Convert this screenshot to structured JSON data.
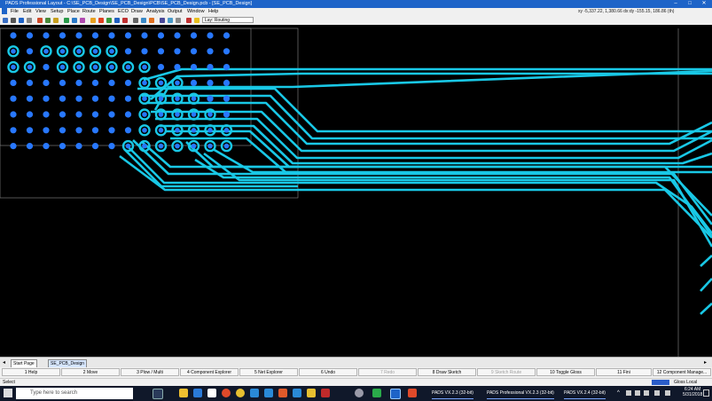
{
  "window": {
    "title": "PADS Professional Layout - C:\\SE_PCB_Design\\SE_PCB_Design\\PCB\\SE_PCB_Design.pcb - [SE_PCB_Design]",
    "controls": [
      "–",
      "□",
      "✕"
    ]
  },
  "menu": {
    "items": [
      "File",
      "Edit",
      "View",
      "Setup",
      "Place",
      "Route",
      "Planes",
      "ECO",
      "Draw",
      "Analysis",
      "Output",
      "Window",
      "Help"
    ],
    "coords": "xy -5,337.22, 1,380.66  dx:dy -155.15, 186.86 (th)"
  },
  "toolbar": {
    "layer_select": "Lay: Routing"
  },
  "sheet_tabs": [
    "Start Page",
    "SE_PCB_Design"
  ],
  "function_keys": [
    {
      "label": "1 Help",
      "enabled": true
    },
    {
      "label": "2 Move",
      "enabled": true
    },
    {
      "label": "3 Plow / Multi",
      "enabled": true
    },
    {
      "label": "4 Component Explorer",
      "enabled": true
    },
    {
      "label": "5 Net Explorer",
      "enabled": true
    },
    {
      "label": "6 Undo",
      "enabled": true
    },
    {
      "label": "7 Redo",
      "enabled": false
    },
    {
      "label": "8 Draw Sketch",
      "enabled": true
    },
    {
      "label": "9 Sketch Route",
      "enabled": false
    },
    {
      "label": "10 Toggle Gloss",
      "enabled": true
    },
    {
      "label": "11 Fini",
      "enabled": true
    },
    {
      "label": "12 Component Manage...",
      "enabled": true
    }
  ],
  "status": {
    "mode": "Select",
    "gloss": "Gloss Local"
  },
  "taskbar": {
    "search_placeholder": "Type here to search",
    "tasks": [
      "PADS VX.2.3 (32-bit)",
      "PADS Professional VX.2.3 (32-bit)",
      "PADS VX.2.4 (32-bit)"
    ],
    "time": "6:24 AM",
    "date": "5/31/2018"
  },
  "colors": {
    "trace": "#19c8e6",
    "pad": "#2878ff",
    "board_outline": "#8a8a8a",
    "titlebar": "#1e64c8"
  }
}
